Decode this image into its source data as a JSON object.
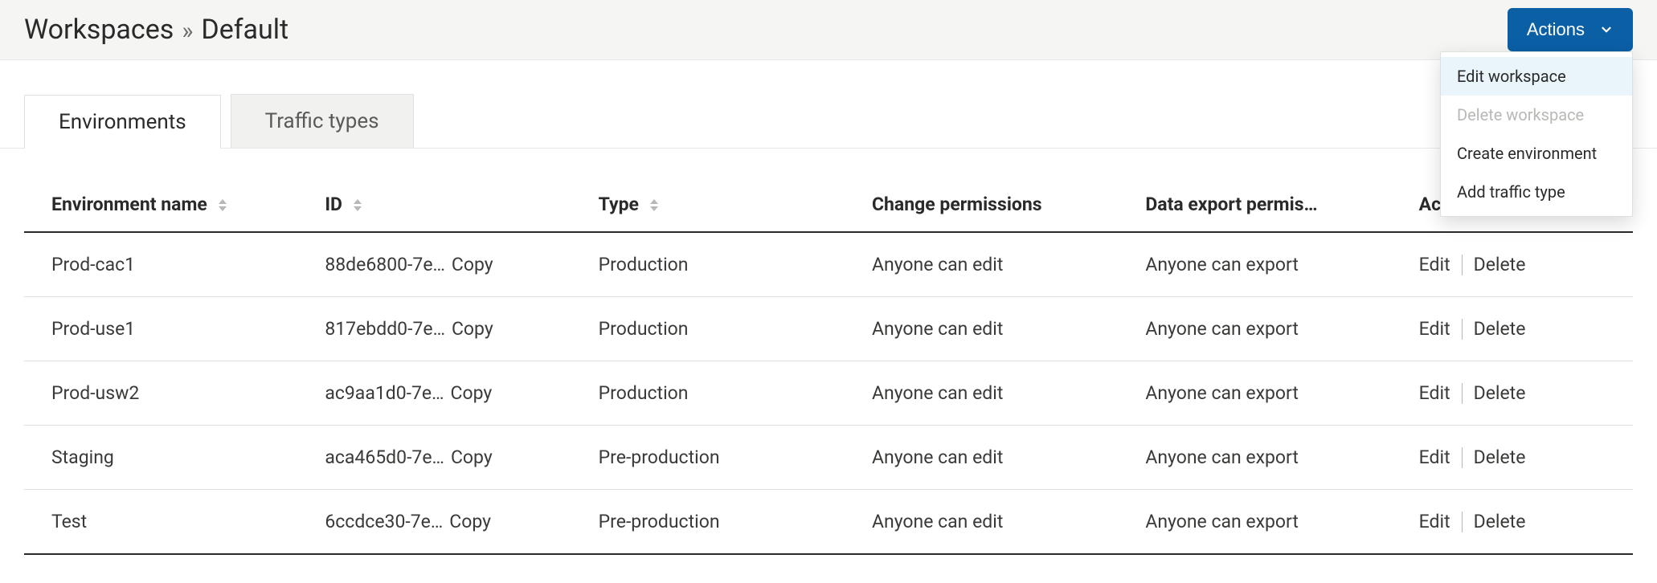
{
  "breadcrumb": {
    "root": "Workspaces",
    "separator": "»",
    "current": "Default"
  },
  "actions_button": {
    "label": "Actions"
  },
  "dropdown": {
    "items": [
      {
        "label": "Edit workspace",
        "highlight": true
      },
      {
        "label": "Delete workspace",
        "disabled": true
      },
      {
        "label": "Create environment"
      },
      {
        "label": "Add traffic type"
      }
    ]
  },
  "tabs": [
    {
      "label": "Environments",
      "active": true
    },
    {
      "label": "Traffic types",
      "active": false
    }
  ],
  "table": {
    "columns": {
      "env_name": "Environment name",
      "id": "ID",
      "type": "Type",
      "change_perms": "Change permissions",
      "export_perms": "Data export permis…",
      "actions": "Actions"
    },
    "copy_label": "Copy",
    "edit_label": "Edit",
    "delete_label": "Delete",
    "rows": [
      {
        "name": "Prod-cac1",
        "id": "88de6800-7e…",
        "type": "Production",
        "change": "Anyone can edit",
        "export": "Anyone can export"
      },
      {
        "name": "Prod-use1",
        "id": "817ebdd0-7e…",
        "type": "Production",
        "change": "Anyone can edit",
        "export": "Anyone can export"
      },
      {
        "name": "Prod-usw2",
        "id": "ac9aa1d0-7e…",
        "type": "Production",
        "change": "Anyone can edit",
        "export": "Anyone can export"
      },
      {
        "name": "Staging",
        "id": "aca465d0-7e…",
        "type": "Pre-production",
        "change": "Anyone can edit",
        "export": "Anyone can export"
      },
      {
        "name": "Test",
        "id": "6ccdce30-7e…",
        "type": "Pre-production",
        "change": "Anyone can edit",
        "export": "Anyone can export"
      }
    ]
  }
}
